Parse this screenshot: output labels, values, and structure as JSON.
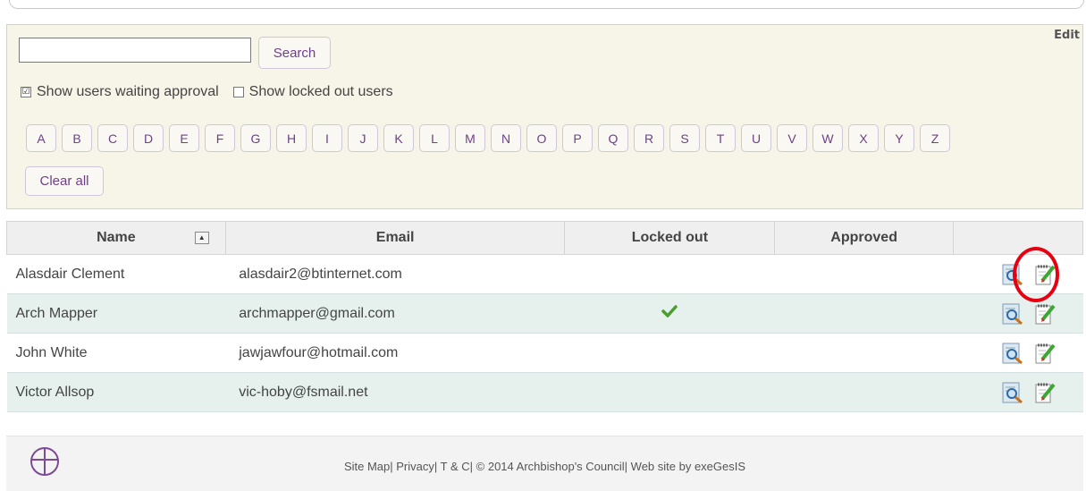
{
  "filter": {
    "edit_label": "Edit",
    "search_placeholder": "",
    "search_button": "Search",
    "show_waiting_label": "Show users waiting approval",
    "show_waiting_checked": true,
    "show_locked_label": "Show locked out users",
    "show_locked_checked": false,
    "letters": [
      "A",
      "B",
      "C",
      "D",
      "E",
      "F",
      "G",
      "H",
      "I",
      "J",
      "K",
      "L",
      "M",
      "N",
      "O",
      "P",
      "Q",
      "R",
      "S",
      "T",
      "U",
      "V",
      "W",
      "X",
      "Y",
      "Z"
    ],
    "clear_all": "Clear all"
  },
  "table": {
    "headers": {
      "name": "Name",
      "email": "Email",
      "locked": "Locked out",
      "approved": "Approved"
    },
    "rows": [
      {
        "name": "Alasdair Clement",
        "email": "alasdair2@btinternet.com",
        "locked": false,
        "approved": false
      },
      {
        "name": "Arch Mapper",
        "email": "archmapper@gmail.com",
        "locked": true,
        "approved": false
      },
      {
        "name": "John White",
        "email": "jawjawfour@hotmail.com",
        "locked": false,
        "approved": false
      },
      {
        "name": "Victor Allsop",
        "email": "vic-hoby@fsmail.net",
        "locked": false,
        "approved": false
      }
    ],
    "icons": {
      "view": "view-details-icon",
      "edit": "edit-user-icon",
      "locked": "checkmark-icon"
    }
  },
  "footer": {
    "site_map": "Site Map",
    "privacy": "Privacy",
    "tc": "T & C",
    "copyright": "© 2014 Archbishop's Council",
    "credit": "Web site by exeGesIS",
    "logo": "church-of-england-logo-icon"
  },
  "colors": {
    "accent": "#6e3f8a",
    "alt_row": "#e6f1ed",
    "panel_bg": "#f7f4e8",
    "highlight": "#e60012"
  }
}
